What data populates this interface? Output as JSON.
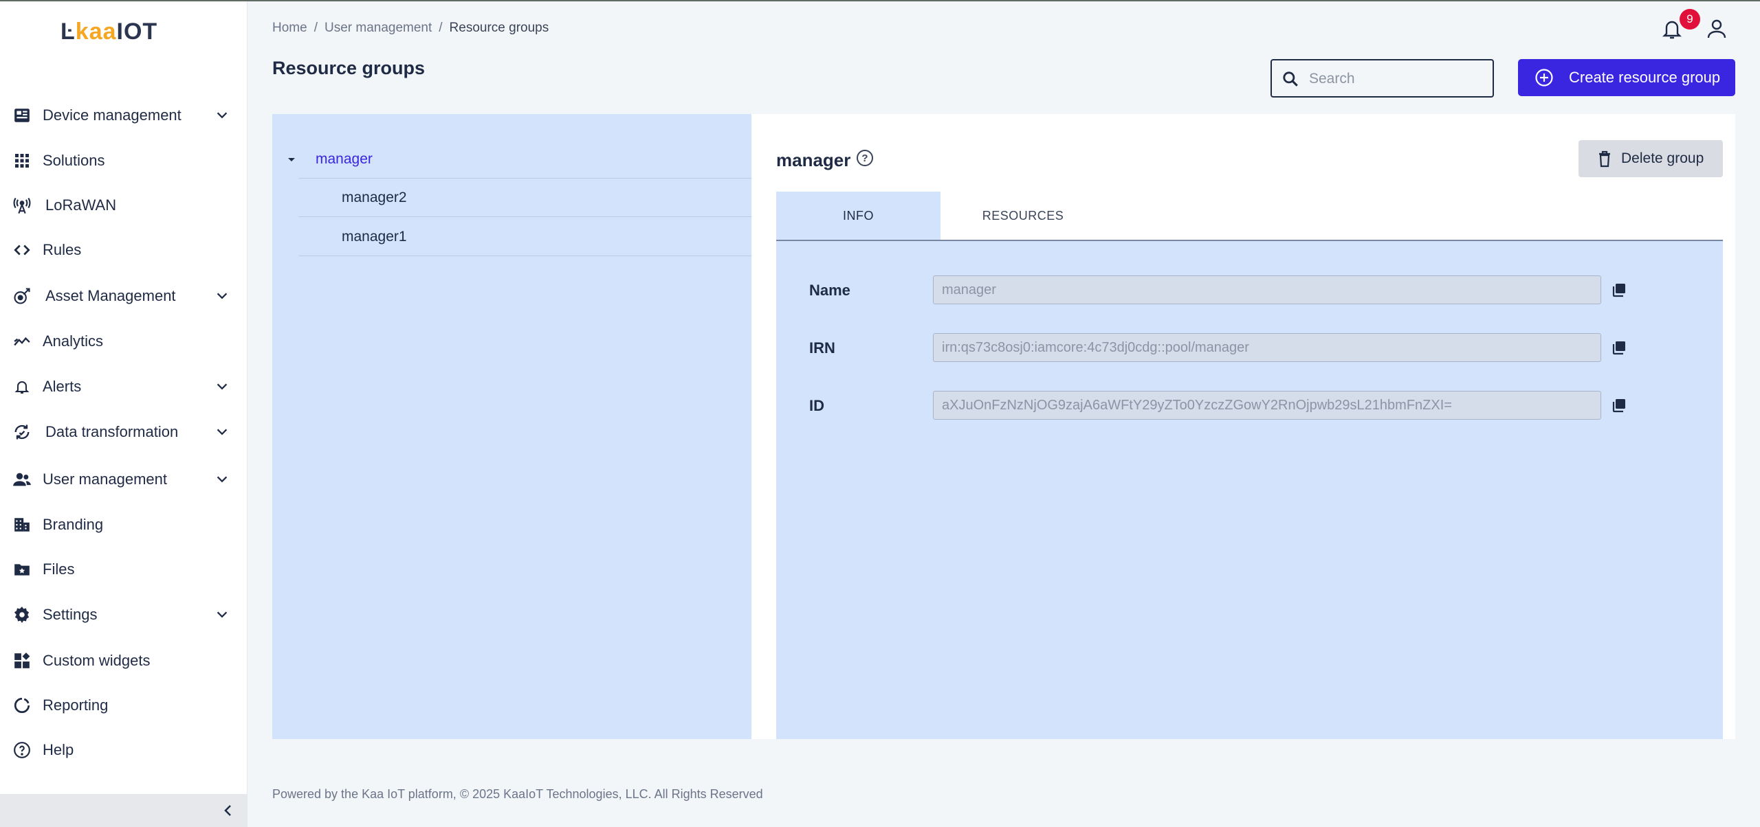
{
  "brand": {
    "logo_part1": "Ŀ",
    "logo_part2": "kaa",
    "logo_part3": "IOT",
    "accent": "#3a25e0",
    "logo_accent": "#f5a623"
  },
  "sidebar": {
    "items": [
      {
        "label": "Device management",
        "icon": "device-icon",
        "expandable": true
      },
      {
        "label": "Solutions",
        "icon": "grid-icon",
        "expandable": false
      },
      {
        "label": "LoRaWAN",
        "icon": "antenna-icon",
        "expandable": false
      },
      {
        "label": "Rules",
        "icon": "code-icon",
        "expandable": false
      },
      {
        "label": "Asset Management",
        "icon": "asset-icon",
        "expandable": true
      },
      {
        "label": "Analytics",
        "icon": "analytics-icon",
        "expandable": false
      },
      {
        "label": "Alerts",
        "icon": "bell-icon",
        "expandable": true
      },
      {
        "label": "Data transformation",
        "icon": "transform-icon",
        "expandable": true
      },
      {
        "label": "User management",
        "icon": "users-icon",
        "expandable": true
      },
      {
        "label": "Branding",
        "icon": "building-icon",
        "expandable": false
      },
      {
        "label": "Files",
        "icon": "folder-icon",
        "expandable": false
      },
      {
        "label": "Settings",
        "icon": "gear-icon",
        "expandable": true
      },
      {
        "label": "Custom widgets",
        "icon": "widgets-icon",
        "expandable": false
      },
      {
        "label": "Reporting",
        "icon": "reporting-icon",
        "expandable": false
      },
      {
        "label": "Help",
        "icon": "help-icon",
        "expandable": false
      }
    ]
  },
  "header": {
    "breadcrumb": [
      "Home",
      "User management",
      "Resource groups"
    ],
    "notification_count": "9",
    "page_title": "Resource groups",
    "search_placeholder": "Search",
    "create_button": "Create resource group"
  },
  "tree": {
    "root": "manager",
    "children": [
      "manager2",
      "manager1"
    ]
  },
  "detail": {
    "title": "manager",
    "help": "?",
    "delete_button": "Delete group",
    "tabs": [
      "INFO",
      "RESOURCES"
    ],
    "active_tab": "INFO",
    "fields": [
      {
        "label": "Name",
        "value": "manager"
      },
      {
        "label": "IRN",
        "value": "irn:qs73c8osj0:iamcore:4c73dj0cdg::pool/manager"
      },
      {
        "label": "ID",
        "value": "aXJuOnFzNzNjOG9zajA6aWFtY29yZTo0YzczZGowY2RnOjpwb29sL21hbmFnZXI="
      }
    ]
  },
  "footer": "Powered by the Kaa IoT platform, © 2025 KaaIoT Technologies, LLC. All Rights Reserved"
}
